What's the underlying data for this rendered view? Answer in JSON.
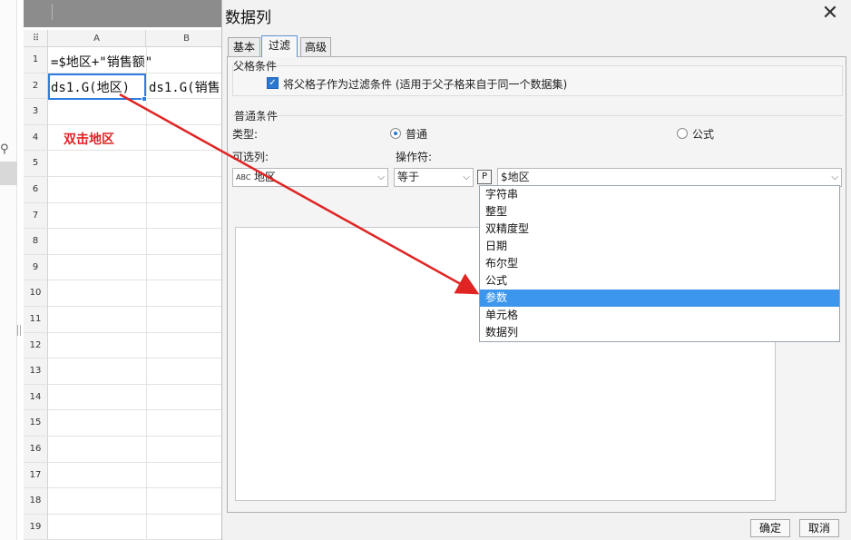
{
  "sheet": {
    "corner_glyph": "⠿",
    "columns": [
      "A",
      "B"
    ],
    "rows": [
      "1",
      "2",
      "3",
      "4",
      "5",
      "6",
      "7",
      "8",
      "9",
      "10",
      "11",
      "12",
      "13",
      "14",
      "15",
      "16",
      "17",
      "18",
      "19"
    ],
    "a1": "=$地区+\"销售额\"",
    "a2": "ds1.G(地区)",
    "b2": "ds1.G(销售",
    "note": "双击地区",
    "note_color": "#e02424"
  },
  "dialog": {
    "title": "数据列",
    "tabs": [
      "基本",
      "过滤",
      "高级"
    ],
    "active_tab": "过滤",
    "parent_section": "父格条件",
    "parent_checkbox_label": "将父格子作为过滤条件 (适用于父子格来自于同一个数据集)",
    "parent_checkbox_checked": true,
    "common_section": "普通条件",
    "type_label": "类型:",
    "type_options": [
      "普通",
      "公式"
    ],
    "type_selected": "普通",
    "optional_label": "可选列:",
    "operator_label": "操作符:",
    "field_value": "地区",
    "field_icon_text": "ABC",
    "operator_value": "等于",
    "param_button": "P",
    "value_text": "$地区",
    "dropdown_options": [
      "字符串",
      "整型",
      "双精度型",
      "日期",
      "布尔型",
      "公式",
      "参数",
      "单元格",
      "数据列"
    ],
    "dropdown_selected": "参数",
    "ok_label": "确定",
    "cancel_label": "取消",
    "accent_color": "#3c97ec"
  }
}
